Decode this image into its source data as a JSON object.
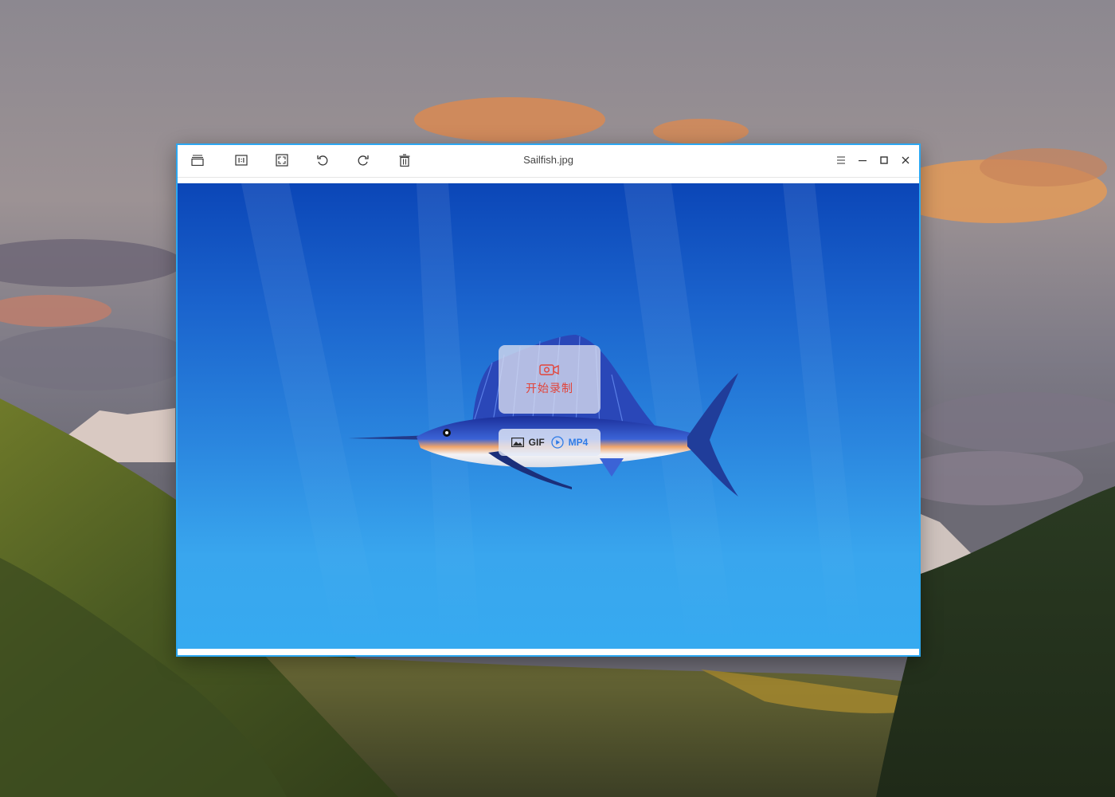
{
  "window": {
    "title": "Sailfish.jpg",
    "accent": "#2ca7f1"
  },
  "toolbar": {
    "buttons": [
      {
        "name": "thumbnail-view",
        "icon": "album-icon"
      },
      {
        "name": "original-size",
        "icon": "one-to-one-icon"
      },
      {
        "name": "fit-window",
        "icon": "fit-window-icon"
      },
      {
        "name": "rotate-left",
        "icon": "rotate-ccw-icon"
      },
      {
        "name": "rotate-right",
        "icon": "rotate-cw-icon"
      },
      {
        "name": "delete",
        "icon": "trash-icon"
      }
    ]
  },
  "window_controls": {
    "menu": "menu-icon",
    "minimize": "minimize-icon",
    "maximize": "maximize-icon",
    "close": "close-icon"
  },
  "recorder": {
    "start_label": "开始录制",
    "start_color": "#e2443a",
    "formats": [
      {
        "label": "GIF",
        "selected": false
      },
      {
        "label": "MP4",
        "selected": true,
        "color": "#2f7be6"
      }
    ]
  }
}
